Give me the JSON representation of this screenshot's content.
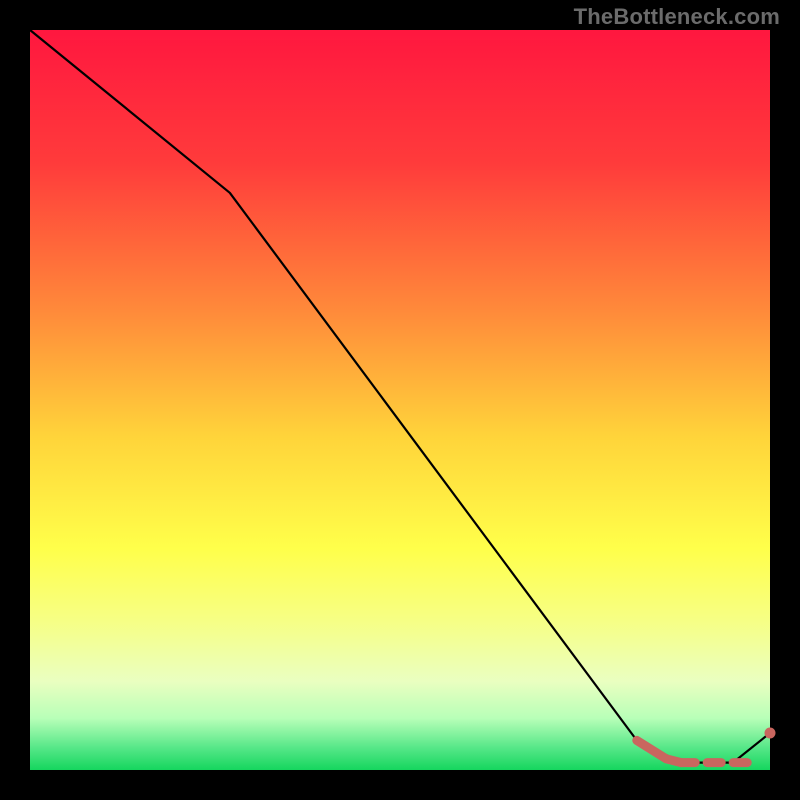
{
  "attribution": "TheBottleneck.com",
  "chart_data": {
    "type": "line",
    "title": "",
    "xlabel": "",
    "ylabel": "",
    "xlim": [
      0,
      100
    ],
    "ylim": [
      0,
      100
    ],
    "gradient_stops": [
      {
        "offset": 0,
        "color": "#ff173f"
      },
      {
        "offset": 18,
        "color": "#ff3b3b"
      },
      {
        "offset": 38,
        "color": "#ff8a3a"
      },
      {
        "offset": 55,
        "color": "#ffd43a"
      },
      {
        "offset": 70,
        "color": "#ffff4a"
      },
      {
        "offset": 80,
        "color": "#f6ff86"
      },
      {
        "offset": 88,
        "color": "#eaffc0"
      },
      {
        "offset": 93,
        "color": "#b8ffb8"
      },
      {
        "offset": 97,
        "color": "#56e788"
      },
      {
        "offset": 100,
        "color": "#15d65e"
      }
    ],
    "series": [
      {
        "name": "bottleneck-curve",
        "x": [
          0,
          27,
          82,
          88,
          95,
          100
        ],
        "y": [
          100,
          78,
          4,
          1,
          1,
          5
        ]
      }
    ],
    "highlight_segment": {
      "x_start": 82,
      "x_end": 97,
      "color": "#c9665f"
    },
    "highlight_end_point": {
      "x": 100,
      "y": 5,
      "color": "#c9665f"
    }
  }
}
